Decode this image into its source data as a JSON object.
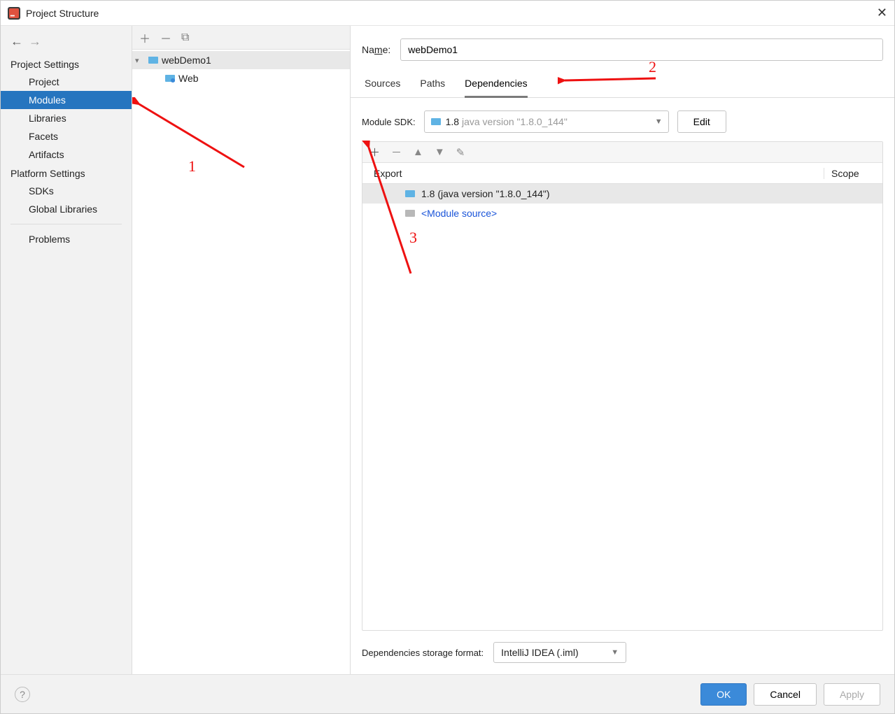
{
  "window": {
    "title": "Project Structure"
  },
  "sidebar": {
    "section_project": "Project Settings",
    "items_project": [
      "Project",
      "Modules",
      "Libraries",
      "Facets",
      "Artifacts"
    ],
    "section_platform": "Platform Settings",
    "items_platform": [
      "SDKs",
      "Global Libraries"
    ],
    "problems": "Problems"
  },
  "tree": {
    "root": "webDemo1",
    "child": "Web"
  },
  "form": {
    "name_label": "Name:",
    "name_value": "webDemo1"
  },
  "tabs": [
    "Sources",
    "Paths",
    "Dependencies"
  ],
  "sdk": {
    "label": "Module SDK:",
    "value_main": "1.8",
    "value_grey": "java version \"1.8.0_144\"",
    "edit": "Edit"
  },
  "dep_table": {
    "header_export": "Export",
    "header_scope": "Scope",
    "rows": [
      {
        "text": "1.8 (java version \"1.8.0_144\")",
        "icon": "folder",
        "link": false
      },
      {
        "text": "<Module source>",
        "icon": "gfolder",
        "link": true
      }
    ]
  },
  "storage": {
    "label": "Dependencies storage format:",
    "value": "IntelliJ IDEA (.iml)"
  },
  "footer": {
    "ok": "OK",
    "cancel": "Cancel",
    "apply": "Apply"
  },
  "annotations": {
    "a1": "1",
    "a2": "2",
    "a3": "3"
  }
}
